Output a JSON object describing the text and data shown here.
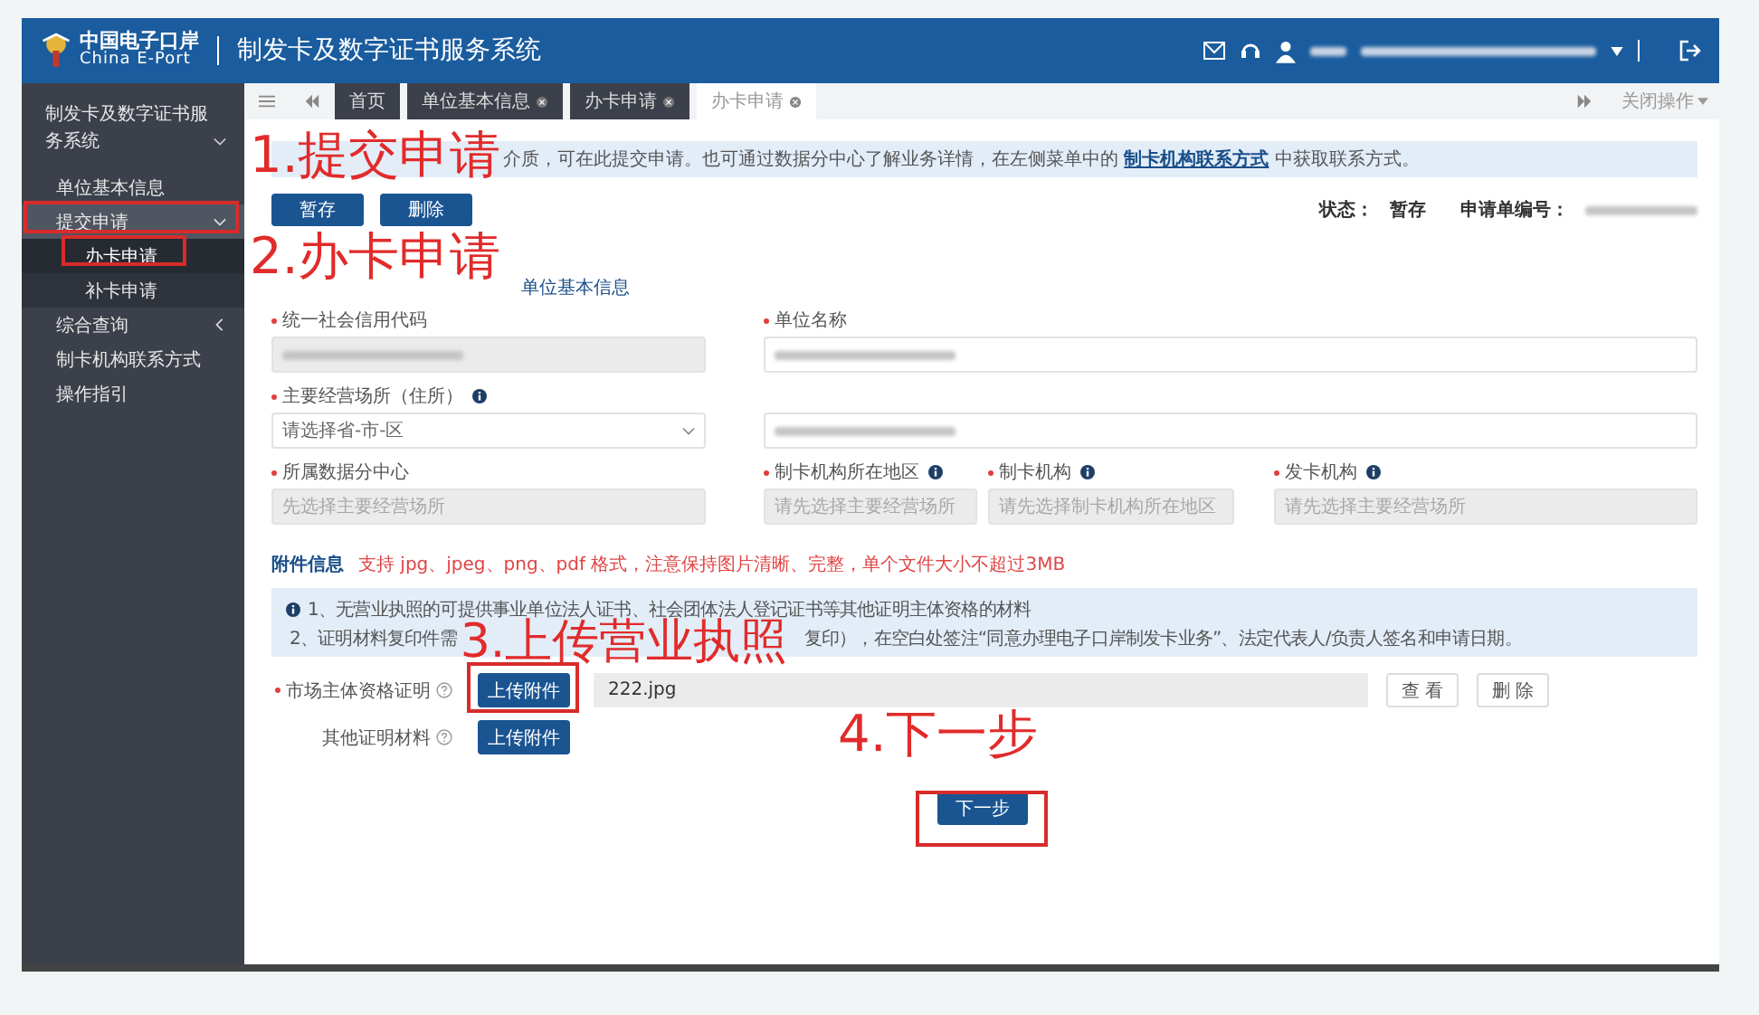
{
  "header": {
    "logo_cn": "中国电子口岸",
    "logo_en": "China E-Port",
    "title": "制发卡及数字证书服务系统"
  },
  "sidebar": {
    "title": "制发卡及数字证书服务系统",
    "items": [
      {
        "label": "单位基本信息",
        "selected": false
      },
      {
        "label": "提交申请",
        "selected": true,
        "expanded": true,
        "children": [
          {
            "label": "办卡申请",
            "selected": true
          },
          {
            "label": "补卡申请",
            "selected": false
          }
        ]
      },
      {
        "label": "综合查询",
        "selected": false,
        "expanded": false
      },
      {
        "label": "制卡机构联系方式",
        "selected": false
      },
      {
        "label": "操作指引",
        "selected": false
      }
    ]
  },
  "tabs": [
    {
      "label": "首页",
      "selected": false,
      "closable": false
    },
    {
      "label": "单位基本信息",
      "selected": false,
      "closable": true
    },
    {
      "label": "办卡申请",
      "selected": false,
      "closable": true
    },
    {
      "label": "办卡申请",
      "selected": true,
      "closable": true
    }
  ],
  "tab_menu": "关闭操作",
  "notice": {
    "text": "介质，可在此提交申请。也可通过数据分中心了解业务详情，在左侧菜单中的",
    "link": "制卡机构联系方式",
    "after": "中获取联系方式。"
  },
  "actions": [
    "暂存",
    "删除"
  ],
  "status": {
    "label": "状态：",
    "value": "暂存",
    "number_label": "申请单编号："
  },
  "section_title": "单位基本信息",
  "fields": [
    {
      "label": "统一社会信用代码",
      "required": true,
      "kind": "redacted",
      "disabled": true
    },
    {
      "label": "单位名称",
      "required": true,
      "kind": "redacted",
      "disabled": false
    },
    {
      "label": "主要经营场所（住所）",
      "required": true,
      "info": true,
      "kind": "select",
      "value": "请选择省-市-区",
      "disabled": false
    },
    {
      "kind": "redacted",
      "disabled": false
    },
    {
      "label": "所属数据分中心",
      "required": true,
      "kind": "input",
      "placeholder": "先选择主要经营场所",
      "disabled": true
    },
    {
      "label": "制卡机构所在地区",
      "required": true,
      "info": true,
      "kind": "input",
      "placeholder": "请先选择主要经营场所",
      "disabled": true
    },
    {
      "label": "制卡机构",
      "required": true,
      "info": true,
      "kind": "input",
      "placeholder": "请先选择制卡机构所在地区",
      "disabled": true
    },
    {
      "label": "发卡机构",
      "required": true,
      "info": true,
      "kind": "input",
      "placeholder": "请先选择主要经营场所",
      "disabled": true
    }
  ],
  "attachments": {
    "title": "附件信息",
    "hint": "支持 jpg、jpeg、png、pdf 格式，注意保持图片清晰、完整，单个文件大小不超过3MB",
    "notes": [
      "1、无营业执照的可提供事业单位法人证书、社会团体法人登记证书等其他证明主体资格的材料",
      "2、证明材料复印件需",
      "复印），在空白处签注“同意办理电子口岸制发卡业务”、法定代表人/负责人签名和申请日期。"
    ],
    "rows": [
      {
        "label": "市场主体资格证明",
        "required": true,
        "button": "上传附件",
        "file": "222.jpg",
        "view": "查 看",
        "remove": "删 除"
      },
      {
        "label": "其他证明材料",
        "button": "上传附件"
      }
    ]
  },
  "next_button": "下一步",
  "annotations": [
    {
      "text": "1.提交申请",
      "kind": "text"
    },
    {
      "text": "2.办卡申请",
      "kind": "text"
    },
    {
      "text": "3.上传营业执照",
      "kind": "text"
    },
    {
      "text": "4.下一步",
      "kind": "text"
    }
  ]
}
